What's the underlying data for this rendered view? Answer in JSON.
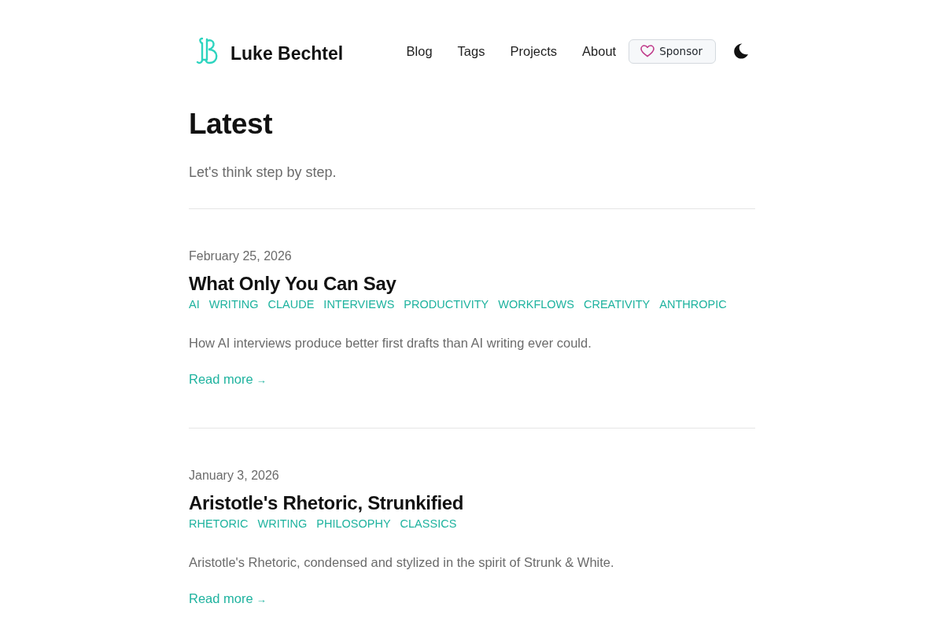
{
  "header": {
    "site_title": "Luke Bechtel",
    "nav": [
      {
        "label": "Blog"
      },
      {
        "label": "Tags"
      },
      {
        "label": "Projects"
      },
      {
        "label": "About"
      }
    ],
    "sponsor_button": {
      "label": "Sponsor"
    }
  },
  "page": {
    "heading": "Latest",
    "tagline": "Let's think step by step."
  },
  "posts": [
    {
      "date": "February 25, 2026",
      "title": "What Only You Can Say",
      "tags": [
        "AI",
        "WRITING",
        "CLAUDE",
        "INTERVIEWS",
        "PRODUCTIVITY",
        "WORKFLOWS",
        "CREATIVITY",
        "ANTHROPIC"
      ],
      "excerpt": "How AI interviews produce better first drafts than AI writing ever could.",
      "read_more": "Read more",
      "arrow": "→"
    },
    {
      "date": "January 3, 2026",
      "title": "Aristotle's Rhetoric, Strunkified",
      "tags": [
        "RHETORIC",
        "WRITING",
        "PHILOSOPHY",
        "CLASSICS"
      ],
      "excerpt": "Aristotle's Rhetoric, condensed and stylized in the spirit of Strunk & White.",
      "read_more": "Read more",
      "arrow": "→"
    }
  ]
}
